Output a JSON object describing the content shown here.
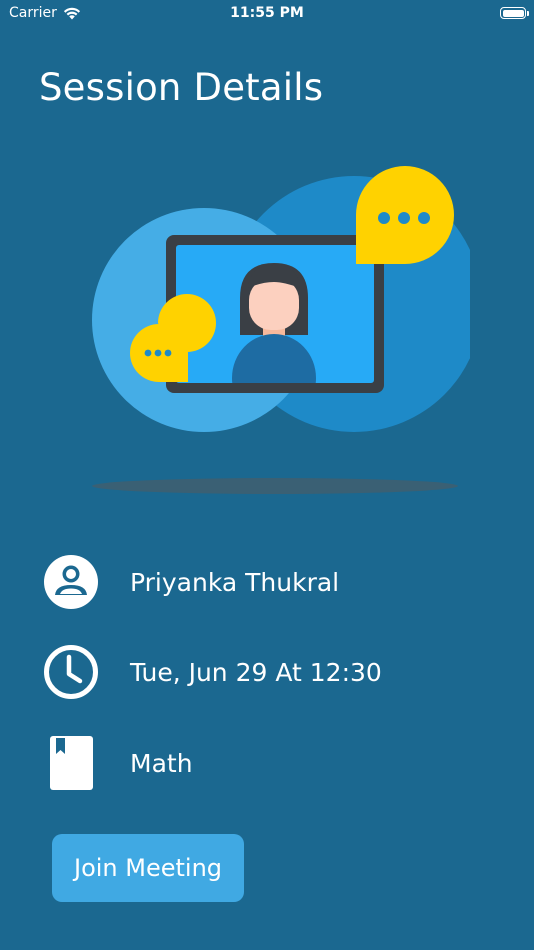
{
  "status_bar": {
    "carrier": "Carrier",
    "time": "11:55 PM",
    "wifi_icon": "wifi-icon",
    "battery_icon": "battery-icon"
  },
  "header": {
    "title": "Session Details"
  },
  "illustration": {
    "icon": "video-call-illustration"
  },
  "details": {
    "tutor": {
      "icon": "person-icon",
      "label": "Priyanka Thukral"
    },
    "schedule": {
      "icon": "clock-icon",
      "label": "Tue, Jun 29 At 12:30"
    },
    "subject": {
      "icon": "book-icon",
      "label": "Math"
    }
  },
  "actions": {
    "join_label": "Join Meeting"
  },
  "colors": {
    "background": "#1b6890",
    "button": "#40a9e3",
    "accent_yellow": "#ffd200"
  }
}
